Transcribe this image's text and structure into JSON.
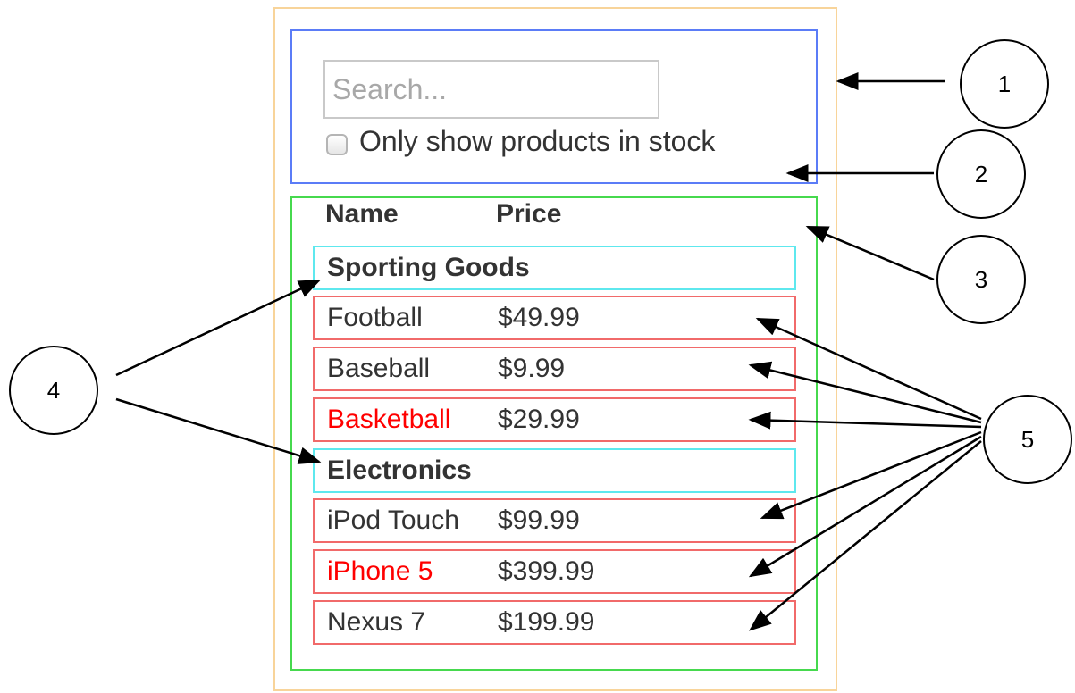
{
  "search_bar": {
    "placeholder": "Search...",
    "checkbox_label": "Only show products in stock"
  },
  "product_table": {
    "headers": {
      "name": "Name",
      "price": "Price"
    },
    "rows": [
      {
        "kind": "category",
        "name": "Sporting Goods"
      },
      {
        "kind": "product",
        "name": "Football",
        "price": "$49.99",
        "in_stock": true
      },
      {
        "kind": "product",
        "name": "Baseball",
        "price": "$9.99",
        "in_stock": true
      },
      {
        "kind": "product",
        "name": "Basketball",
        "price": "$29.99",
        "in_stock": false
      },
      {
        "kind": "category",
        "name": "Electronics"
      },
      {
        "kind": "product",
        "name": "iPod Touch",
        "price": "$99.99",
        "in_stock": true
      },
      {
        "kind": "product",
        "name": "iPhone 5",
        "price": "$399.99",
        "in_stock": false
      },
      {
        "kind": "product",
        "name": "Nexus 7",
        "price": "$199.99",
        "in_stock": true
      }
    ]
  },
  "callouts": [
    "1",
    "2",
    "3",
    "4",
    "5"
  ],
  "colors": {
    "filterable_product_table": "#f8d49a",
    "search_bar": "#5b7cf7",
    "product_table": "#46d94e",
    "product_category_row": "#5ee8ee",
    "product_row": "#f16a6a",
    "out_of_stock_text": "#ff0000"
  }
}
